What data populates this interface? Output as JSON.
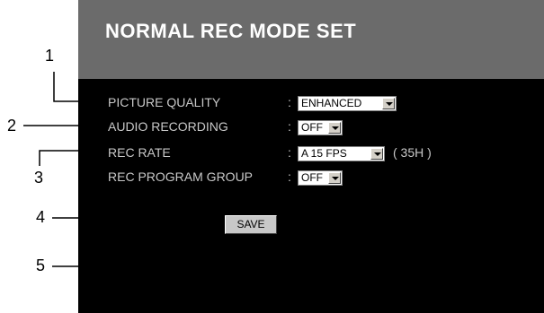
{
  "page": {
    "title": "NORMAL REC MODE SET"
  },
  "settings": [
    {
      "label": "PICTURE QUALITY",
      "colon": ":",
      "value": "ENHANCED"
    },
    {
      "label": "AUDIO RECORDING",
      "colon": ":",
      "value": "OFF"
    },
    {
      "label": "REC RATE",
      "colon": ":",
      "value": "A 15 FPS",
      "extra": "( 35H )"
    },
    {
      "label": "REC PROGRAM GROUP",
      "colon": ":",
      "value": "OFF"
    }
  ],
  "save_label": "SAVE",
  "callouts": [
    "1",
    "2",
    "3",
    "4",
    "5"
  ],
  "colors": {
    "header_bg": "#6b6b6b",
    "panel_bg": "#000000",
    "label_text": "#c8c8c8"
  }
}
